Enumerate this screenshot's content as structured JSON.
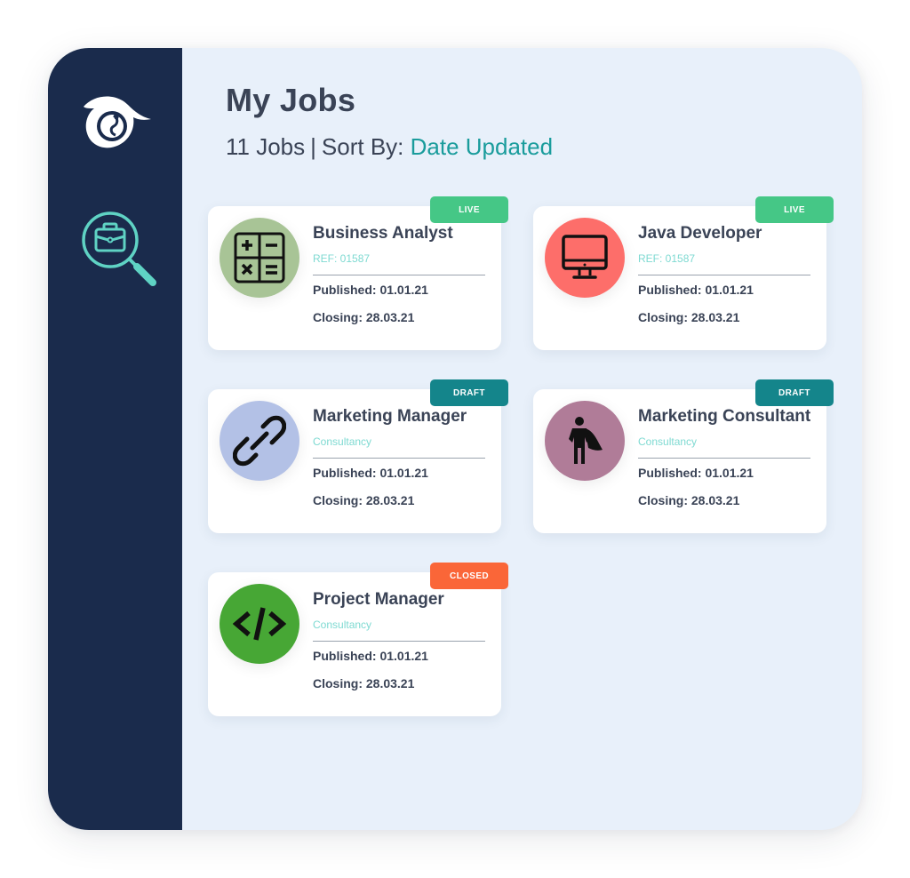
{
  "header": {
    "title": "My Jobs",
    "job_count": "11 Jobs",
    "separator": "|",
    "sort_label": "Sort By:",
    "sort_value": "Date Updated"
  },
  "sidebar": {
    "logo_icon": "eye-logo-icon",
    "items": [
      {
        "name": "jobs-search",
        "icon": "briefcase-search-icon",
        "color": "#5fd3c4"
      }
    ]
  },
  "colors": {
    "sidebar_bg": "#1a2b4c",
    "main_bg": "#e8f0fa",
    "accent": "#1a9c9c",
    "status_live": "#45c786",
    "status_draft": "#14858b",
    "status_closed": "#fa6638"
  },
  "jobs": [
    {
      "title": "Business Analyst",
      "subtitle": "REF: 01587",
      "published": "Published: 01.01.21",
      "closing": "Closing: 28.03.21",
      "status": "LIVE",
      "status_color": "#45c786",
      "icon": "calculator-icon",
      "icon_bg": "#a8c496"
    },
    {
      "title": "Java Developer",
      "subtitle": "REF: 01587",
      "published": "Published: 01.01.21",
      "closing": "Closing: 28.03.21",
      "status": "LIVE",
      "status_color": "#45c786",
      "icon": "monitor-icon",
      "icon_bg": "#fd6e6a"
    },
    {
      "title": "Marketing Manager",
      "subtitle": "Consultancy",
      "published": "Published: 01.01.21",
      "closing": "Closing: 28.03.21",
      "status": "DRAFT",
      "status_color": "#14858b",
      "icon": "link-icon",
      "icon_bg": "#b3c1e6"
    },
    {
      "title": "Marketing Consultant",
      "subtitle": "Consultancy",
      "published": "Published: 01.01.21",
      "closing": "Closing: 28.03.21",
      "status": "DRAFT",
      "status_color": "#14858b",
      "icon": "superhero-icon",
      "icon_bg": "#b07c98"
    },
    {
      "title": "Project Manager",
      "subtitle": "Consultancy",
      "published": "Published: 01.01.21",
      "closing": "Closing: 28.03.21",
      "status": "CLOSED",
      "status_color": "#fa6638",
      "icon": "code-icon",
      "icon_bg": "#47a735"
    }
  ]
}
